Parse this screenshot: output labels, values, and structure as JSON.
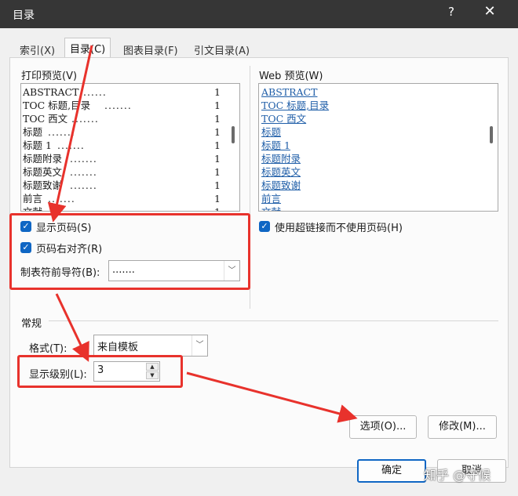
{
  "window": {
    "title": "目录",
    "help_glyph": "?",
    "close_glyph": "✕"
  },
  "tabs": [
    {
      "label": "索引(X)",
      "active": false
    },
    {
      "label": "目录(C)",
      "active": true
    },
    {
      "label": "图表目录(F)",
      "active": false
    },
    {
      "label": "引文目录(A)",
      "active": false
    }
  ],
  "print_preview": {
    "label": "打印预览(V)",
    "rows": [
      {
        "text": "ABSTRACT",
        "page": "1"
      },
      {
        "text": "TOC 标题,目录",
        "page": "1"
      },
      {
        "text": "TOC 西文",
        "page": "1"
      },
      {
        "text": "标题",
        "page": "1"
      },
      {
        "text": "标题 1",
        "page": "1"
      },
      {
        "text": "标题附录",
        "page": "1"
      },
      {
        "text": "标题英文",
        "page": "1"
      },
      {
        "text": "标题致谢",
        "page": "1"
      },
      {
        "text": "前言",
        "page": "1"
      },
      {
        "text": "文献",
        "page": "1"
      }
    ]
  },
  "web_preview": {
    "label": "Web 预览(W)",
    "rows": [
      "ABSTRACT",
      "TOC 标题,目录",
      "TOC 西文",
      "标题",
      "标题 1",
      "标题附录",
      "标题英文",
      "标题致谢",
      "前言",
      "文献"
    ]
  },
  "options": {
    "show_page_numbers": {
      "label": "显示页码(S)",
      "checked": true
    },
    "right_align": {
      "label": "页码右对齐(R)",
      "checked": true
    },
    "tab_leader": {
      "label": "制表符前导符(B):",
      "value": "......."
    },
    "use_hyperlinks": {
      "label": "使用超链接而不使用页码(H)",
      "checked": true
    }
  },
  "general": {
    "label": "常规",
    "format": {
      "label": "格式(T):",
      "value": "来自模板"
    },
    "levels": {
      "label": "显示级别(L):",
      "value": "3"
    }
  },
  "buttons": {
    "options": "选项(O)...",
    "modify": "修改(M)...",
    "ok": "确定",
    "cancel": "取消"
  },
  "watermark": "知乎 @守候",
  "annotation_color": "#e8322c",
  "accent_color": "#0f66c4"
}
